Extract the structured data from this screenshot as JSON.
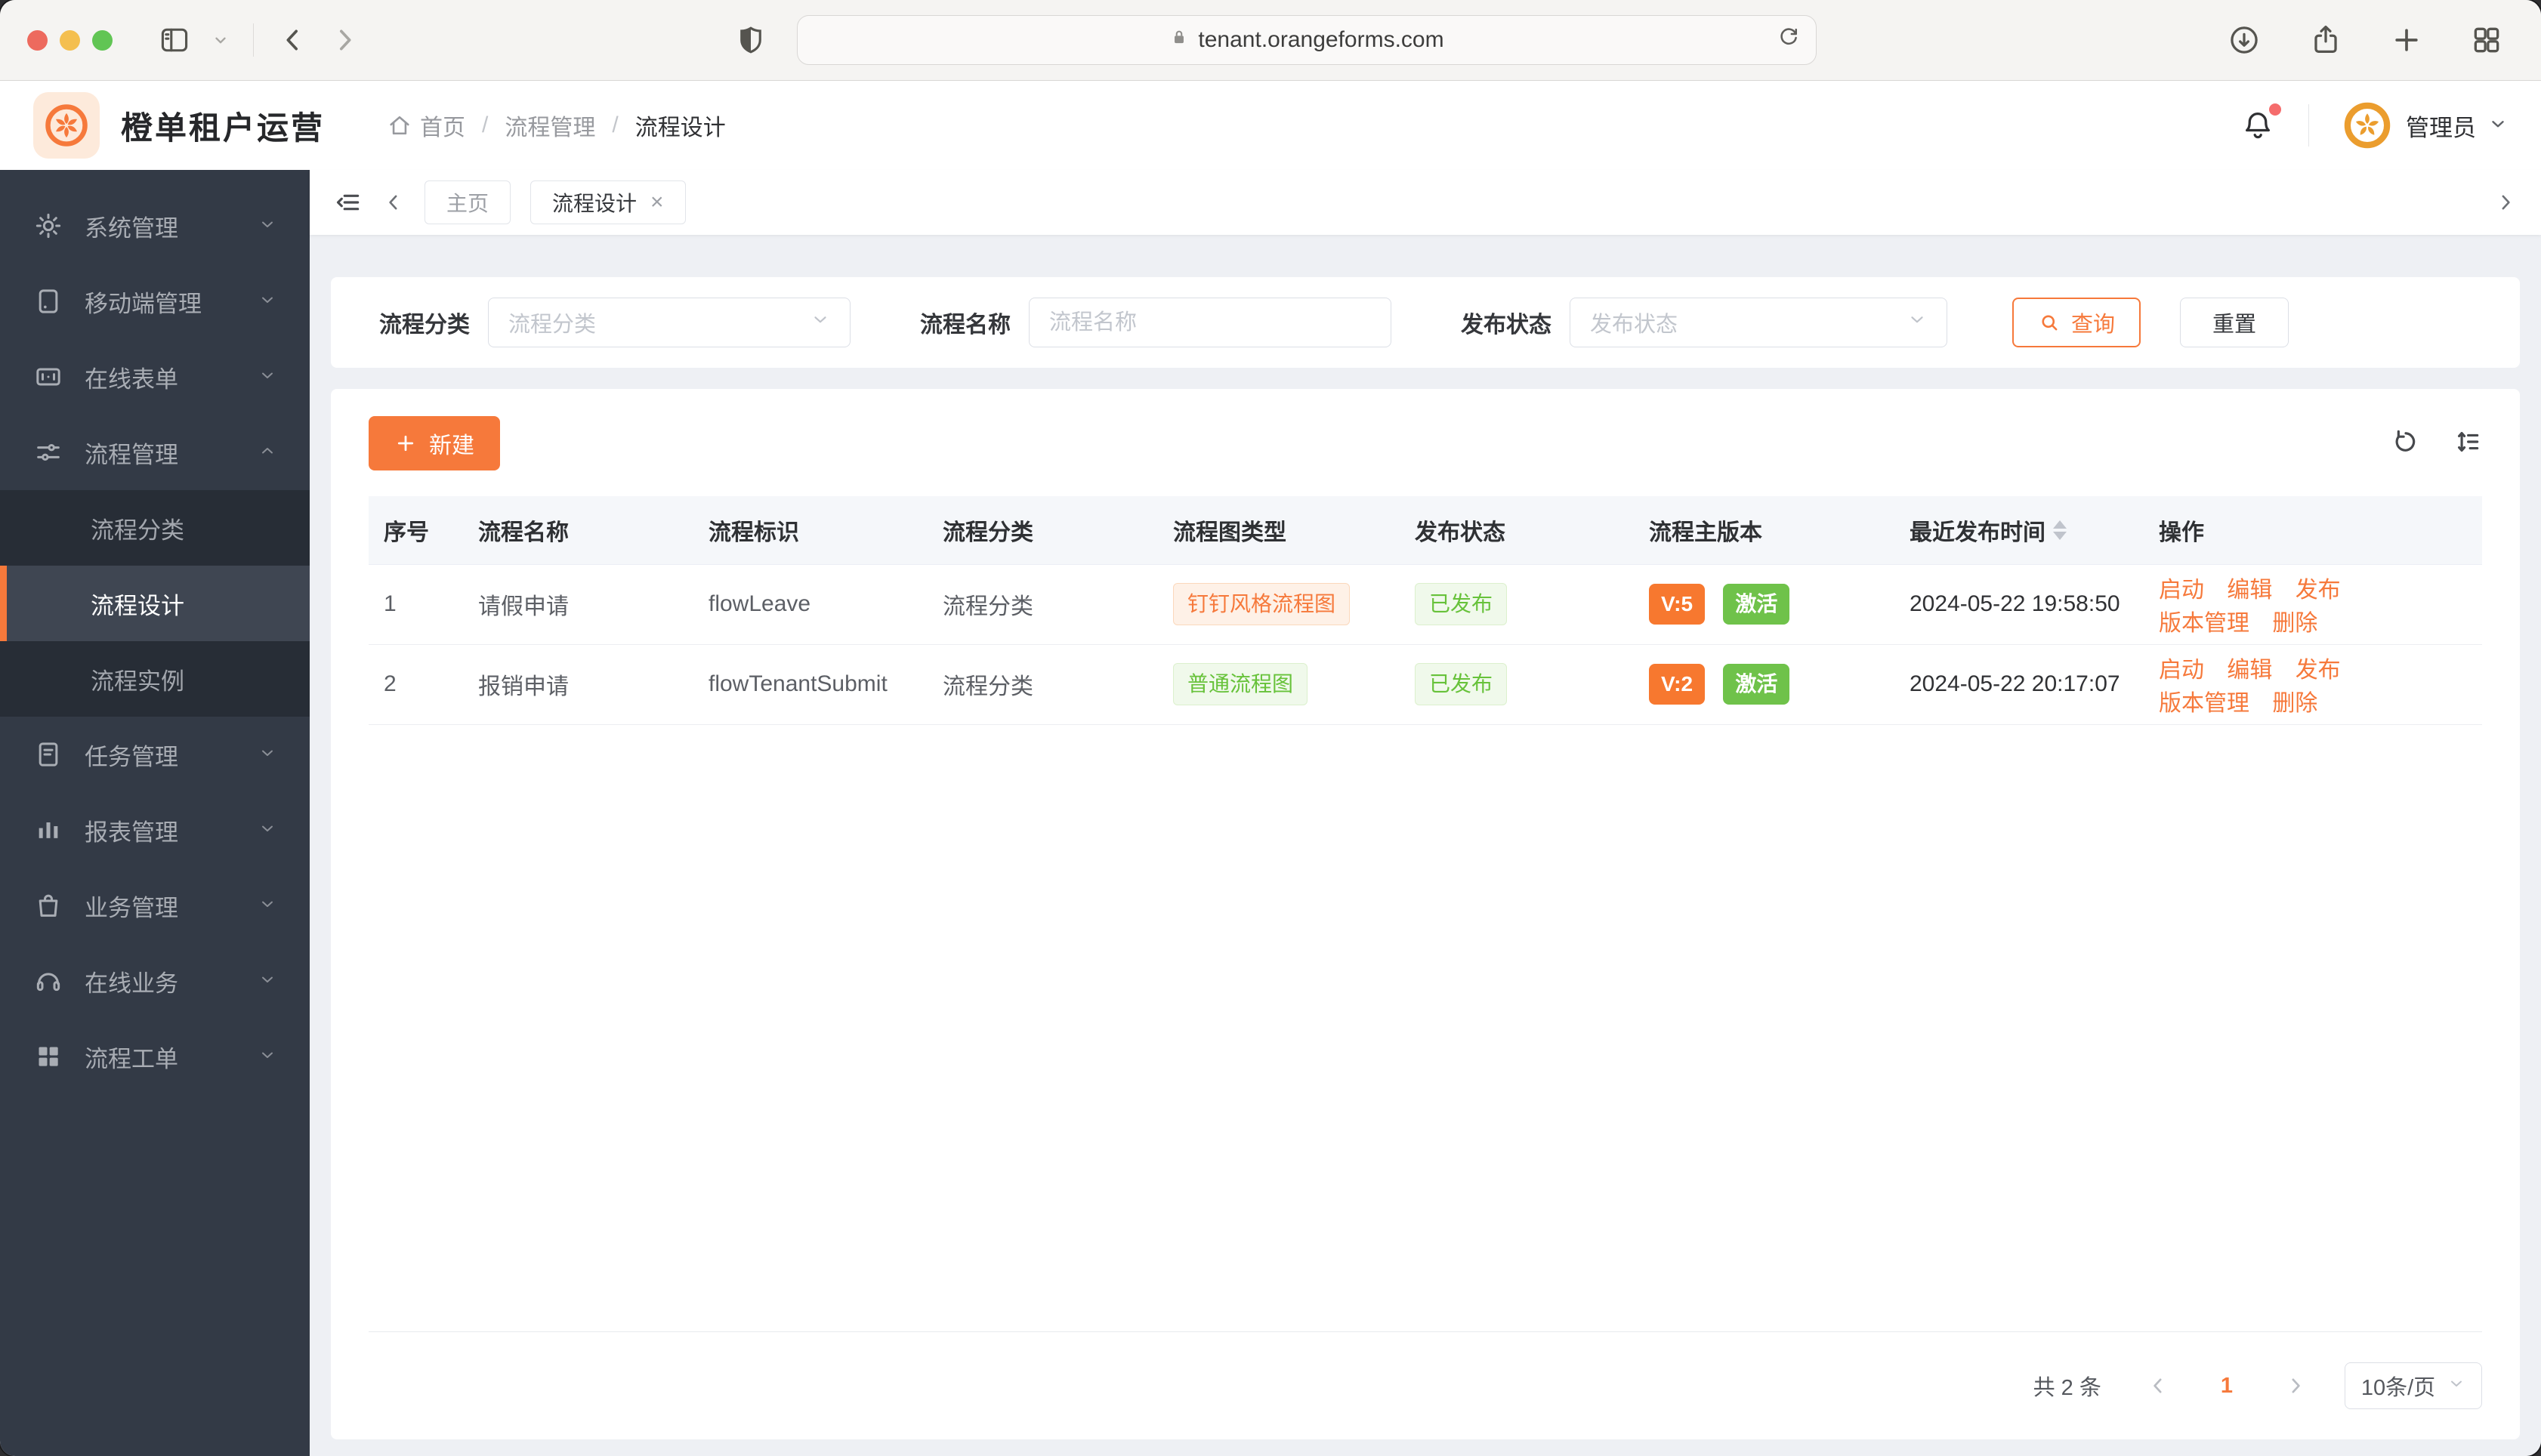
{
  "browser": {
    "url": "tenant.orangeforms.com"
  },
  "header": {
    "app_title": "橙单租户运营",
    "breadcrumb": {
      "home": "首页",
      "section": "流程管理",
      "current": "流程设计",
      "separator": "/"
    },
    "user_name": "管理员"
  },
  "sidebar": {
    "items": [
      {
        "label": "系统管理"
      },
      {
        "label": "移动端管理"
      },
      {
        "label": "在线表单"
      },
      {
        "label": "流程管理"
      },
      {
        "label": "任务管理"
      },
      {
        "label": "报表管理"
      },
      {
        "label": "业务管理"
      },
      {
        "label": "在线业务"
      },
      {
        "label": "流程工单"
      }
    ],
    "submenu": [
      {
        "label": "流程分类"
      },
      {
        "label": "流程设计"
      },
      {
        "label": "流程实例"
      }
    ]
  },
  "tabs": {
    "home": "主页",
    "current": "流程设计",
    "close_glyph": "×"
  },
  "filters": {
    "category_label": "流程分类",
    "category_placeholder": "流程分类",
    "name_label": "流程名称",
    "name_placeholder": "流程名称",
    "status_label": "发布状态",
    "status_placeholder": "发布状态",
    "search_label": "查询",
    "reset_label": "重置"
  },
  "toolbar": {
    "create_label": "新建"
  },
  "table": {
    "headers": [
      "序号",
      "流程名称",
      "流程标识",
      "流程分类",
      "流程图类型",
      "发布状态",
      "流程主版本",
      "最近发布时间",
      "操作"
    ],
    "actions": [
      "启动",
      "编辑",
      "发布",
      "版本管理",
      "删除"
    ],
    "rows": [
      {
        "index": "1",
        "name": "请假申请",
        "key": "flowLeave",
        "category": "流程分类",
        "diagram_type": "钉钉风格流程图",
        "diagram_style": "orange",
        "publish_status": "已发布",
        "version": "V:5",
        "active": "激活",
        "published_at": "2024-05-22 19:58:50"
      },
      {
        "index": "2",
        "name": "报销申请",
        "key": "flowTenantSubmit",
        "category": "流程分类",
        "diagram_type": "普通流程图",
        "diagram_style": "green",
        "publish_status": "已发布",
        "version": "V:2",
        "active": "激活",
        "published_at": "2024-05-22 20:17:07"
      }
    ]
  },
  "pagination": {
    "total": "共 2 条",
    "page": "1",
    "page_size": "10条/页"
  },
  "colors": {
    "accent": "#f6793b",
    "accent_fill": "#f7782f",
    "green_fill": "#6fc24a",
    "green_text": "#67c23a",
    "notification_dot": "#f56c6c"
  }
}
